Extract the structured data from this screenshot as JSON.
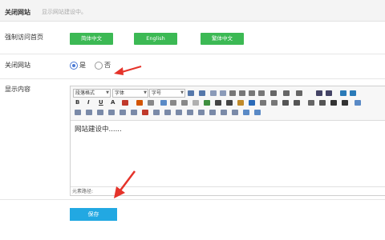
{
  "header": {
    "title": "关闭网站",
    "hint": "显示网站建设中。"
  },
  "homepage": {
    "label": "强制访问首页",
    "buttons": [
      "简体中文",
      "English",
      "繁体中文"
    ]
  },
  "close_site": {
    "label": "关闭网站",
    "options": [
      "是",
      "否"
    ],
    "selected": "是"
  },
  "content_field": {
    "label": "显示内容",
    "toolbar": {
      "paragraph": "段落格式",
      "font": "字体",
      "size": "字号"
    },
    "text": "网站建设中......",
    "element_path": "元素路径:"
  },
  "save_label": "保存",
  "colors": {
    "green_button": "#3cb954",
    "save_button": "#22a8e2",
    "annotation_arrow": "#e5332a"
  }
}
